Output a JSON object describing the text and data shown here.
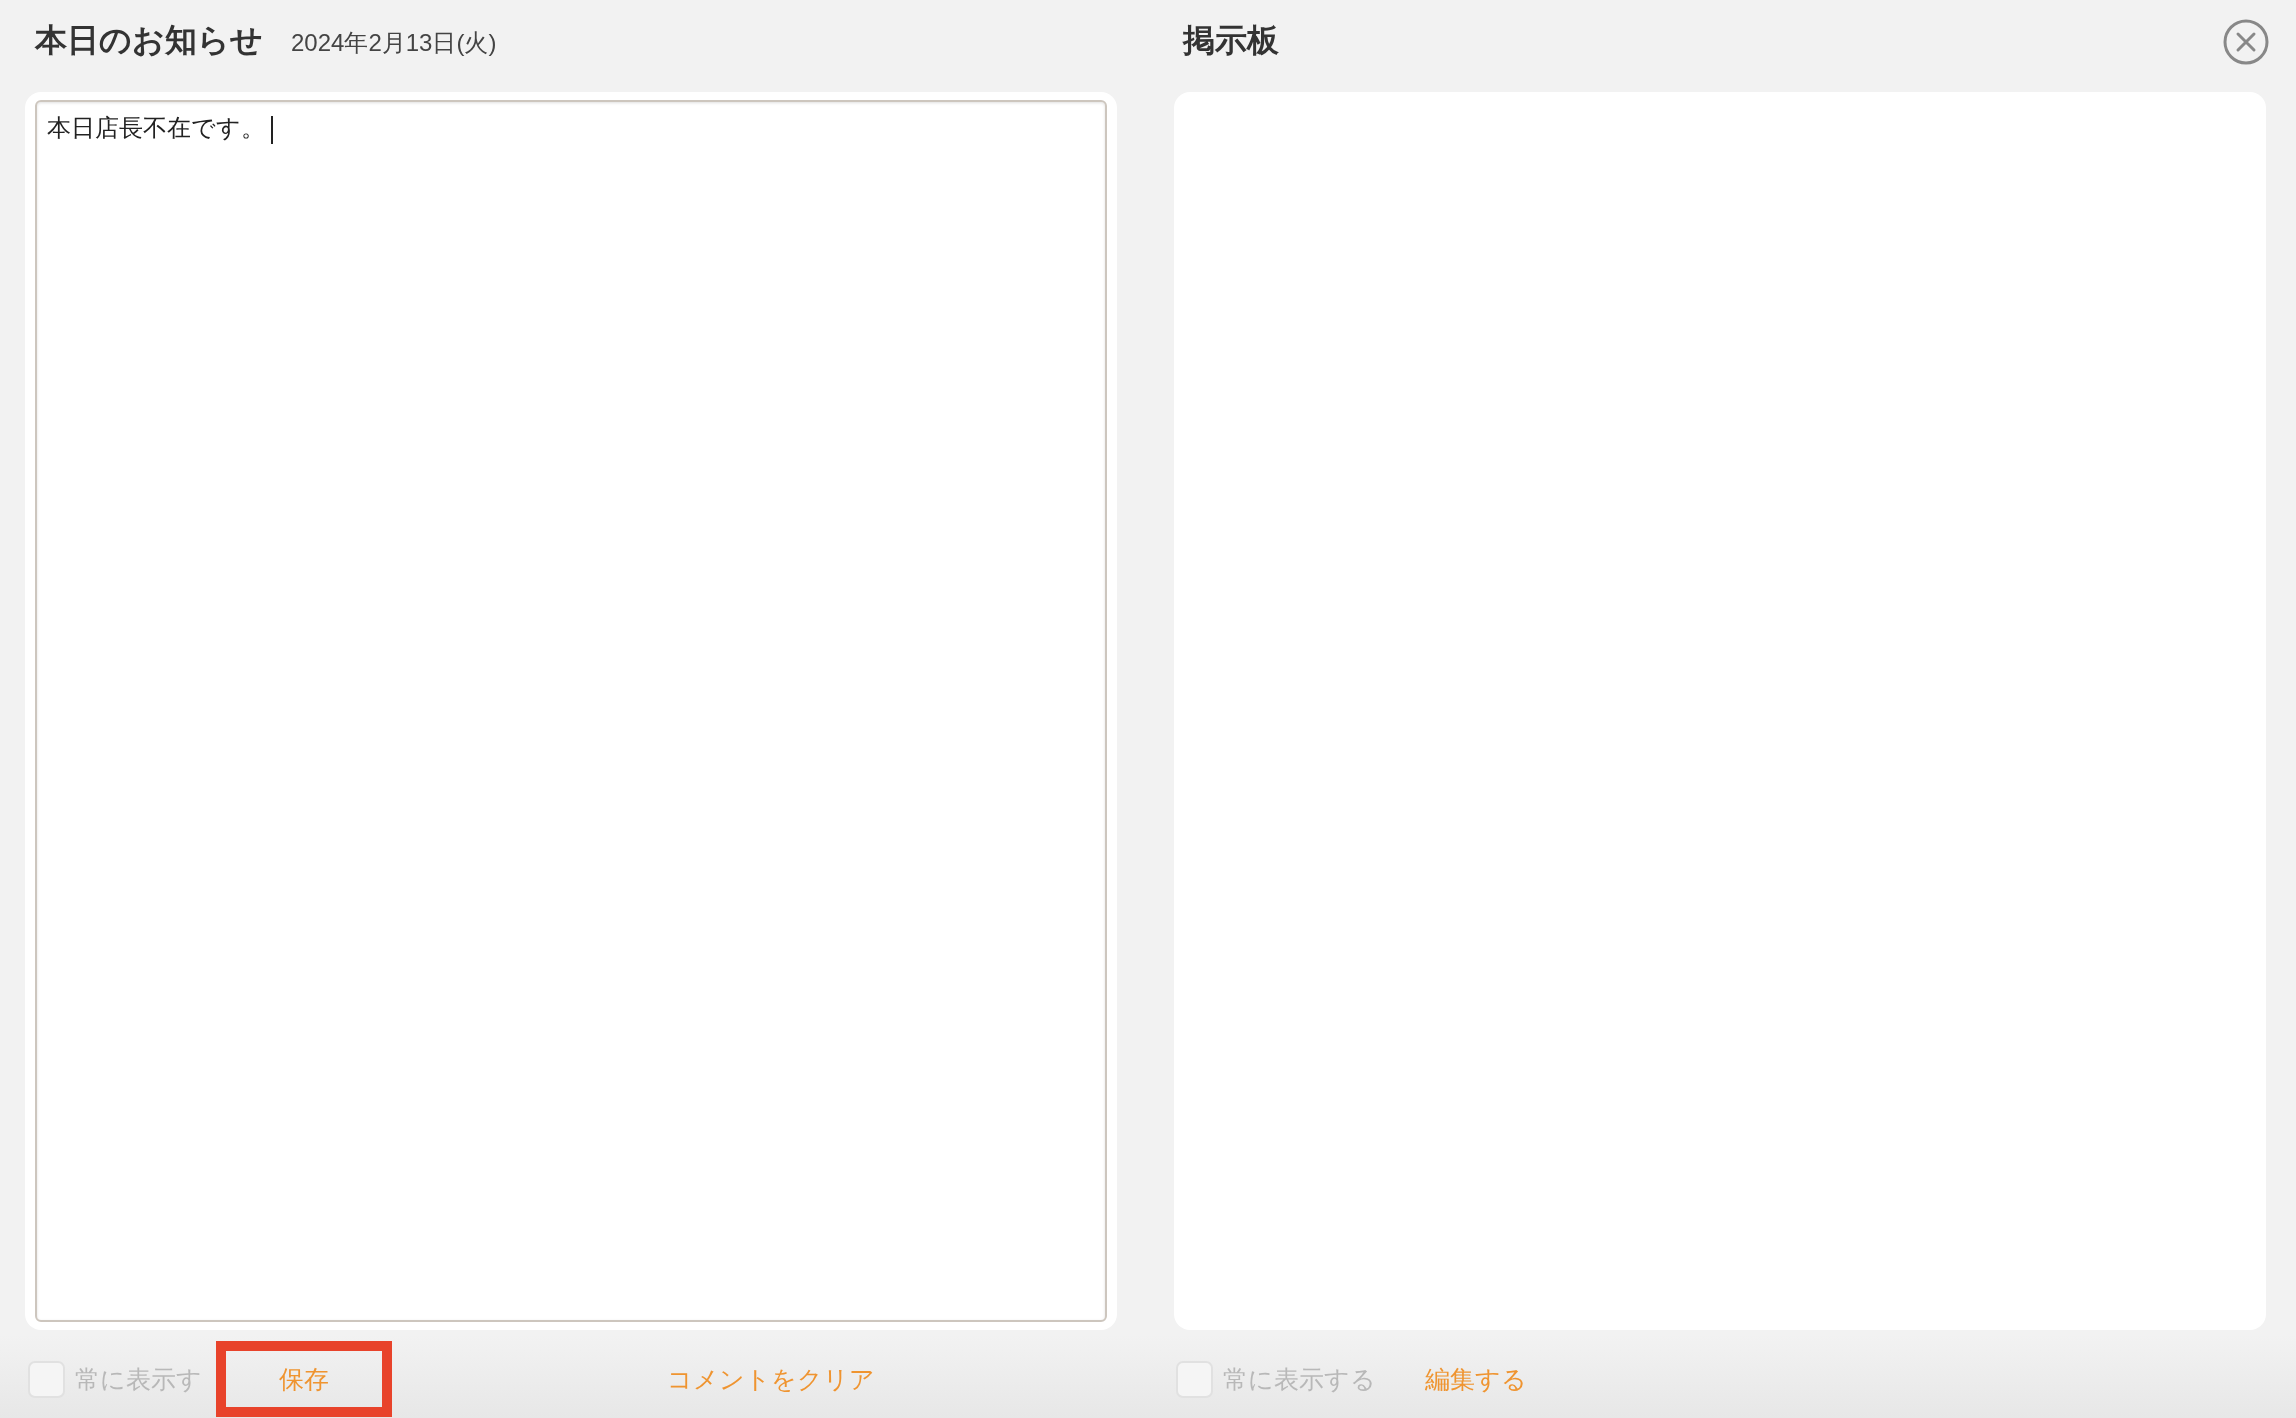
{
  "notice_panel": {
    "title": "本日のお知らせ",
    "date": "2024年2月13日(火)",
    "editor": {
      "value": "本日店長不在です。",
      "focused": true
    },
    "always_show": {
      "label": "常に表示す",
      "checked": false
    },
    "save_button": {
      "label": "保存",
      "highlighted": true
    },
    "clear_link": {
      "label": "コメントをクリア"
    }
  },
  "board_panel": {
    "title": "掲示板",
    "always_show": {
      "label": "常に表示する",
      "checked": false
    },
    "edit_link": {
      "label": "編集する"
    }
  }
}
